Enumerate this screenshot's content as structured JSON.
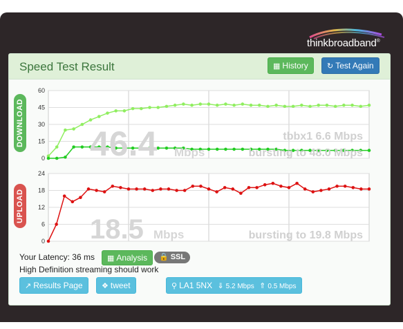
{
  "logo": {
    "part1": "think",
    "part2": "broadband",
    "mark": "®"
  },
  "header": {
    "title": "Speed Test Result",
    "history_label": "History",
    "test_again_label": "Test Again"
  },
  "download": {
    "label": "DOWNLOAD",
    "speed": "46.4",
    "unit": "Mbps",
    "server_label": "tbbx1 6.6 Mbps",
    "bursting_label": "bursting to 48.0 Mbps"
  },
  "upload": {
    "label": "UPLOAD",
    "speed": "18.5",
    "unit": "Mbps",
    "bursting_label": "bursting to 19.8 Mbps"
  },
  "chart_data": [
    {
      "type": "line",
      "title": "",
      "ylim": [
        0,
        60
      ],
      "yticks": [
        0,
        15,
        30,
        45,
        60
      ],
      "grid": true,
      "series": [
        {
          "color": "#90ee60",
          "values": [
            2,
            10,
            25,
            26,
            30,
            34,
            37,
            40,
            42,
            42,
            44,
            44,
            45,
            45,
            46,
            47,
            48,
            47,
            48,
            48,
            47,
            48,
            47,
            48,
            47,
            47,
            46,
            47,
            46,
            46,
            47,
            46,
            47,
            47,
            46,
            47,
            47,
            46,
            47
          ]
        },
        {
          "color": "#22cc22",
          "values": [
            0,
            0,
            1,
            10,
            10,
            10,
            10,
            10,
            9,
            9,
            9,
            9,
            9,
            9,
            9,
            9,
            9,
            8,
            8,
            8,
            8,
            8,
            8,
            8,
            8,
            8,
            8,
            8,
            7,
            7,
            7,
            7,
            7,
            7,
            7,
            7,
            7,
            7,
            7
          ]
        }
      ]
    },
    {
      "type": "line",
      "title": "",
      "ylim": [
        0,
        24
      ],
      "yticks": [
        0,
        6,
        12,
        18,
        24
      ],
      "grid": true,
      "series": [
        {
          "color": "#dd1111",
          "values": [
            0,
            6,
            16,
            14,
            15.5,
            18.5,
            18,
            17.5,
            19.5,
            19,
            18.5,
            18.5,
            18.5,
            18,
            18.5,
            18.5,
            18,
            18,
            19.5,
            19.5,
            18.5,
            17.5,
            19,
            18.5,
            17,
            19,
            19,
            20,
            20.5,
            19.5,
            19,
            20.5,
            18.5,
            17.5,
            18,
            18.5,
            19.5,
            19.5,
            19,
            18.5,
            18.5
          ]
        }
      ]
    }
  ],
  "footer": {
    "latency_text": "Your Latency: 36 ms",
    "analysis_label": "Analysis",
    "ssl_label": "SSL",
    "streaming_text": "High Definition streaming should work",
    "results_page_label": "Results Page",
    "tweet_label": "tweet",
    "location_label": "LA1 5NX",
    "down_speed": "5.2 Mbps",
    "up_speed": "0.5 Mbps"
  },
  "icons": {
    "history": "bar-chart-icon",
    "test_again": "refresh-icon",
    "analysis": "bar-chart-icon",
    "ssl": "lock-icon",
    "results": "external-link-icon",
    "tweet": "twitter-icon",
    "location": "map-marker-icon",
    "down": "arrow-down-circle-icon",
    "up": "arrow-up-circle-icon"
  },
  "colors": {
    "frame": "#2d2628",
    "header_bg": "#dff0d8",
    "title": "#3c763d",
    "download_line": "#90ee60",
    "download_line2": "#22cc22",
    "upload_line": "#dd1111",
    "download_label_bg": "#5cb85c",
    "upload_label_bg": "#d9534f"
  }
}
